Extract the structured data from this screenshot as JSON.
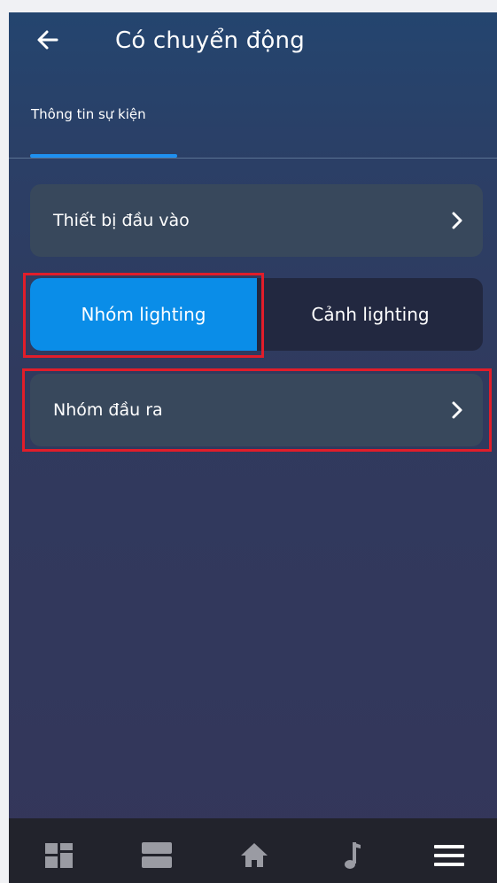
{
  "header": {
    "back_icon": "arrow-left-icon",
    "title": "Có chuyển động"
  },
  "tabs": [
    {
      "label": "Thông tin sự kiện",
      "active": true
    }
  ],
  "input_row": {
    "label": "Thiết bị đầu vào",
    "icon": "chevron-right-icon"
  },
  "segmented": {
    "options": [
      "Nhóm lighting",
      "Cảnh lighting"
    ],
    "selected": "Nhóm lighting"
  },
  "output_row": {
    "label": "Nhóm đầu ra",
    "icon": "chevron-right-icon"
  },
  "bottom_nav": {
    "items": [
      "dashboard-icon",
      "rooms-icon",
      "home-icon",
      "music-icon",
      "menu-icon"
    ]
  },
  "colors": {
    "accent": "#0a8de8",
    "highlight_box": "#e11d2a",
    "row_bg": "#38485c",
    "nav_bg": "#22232c"
  }
}
